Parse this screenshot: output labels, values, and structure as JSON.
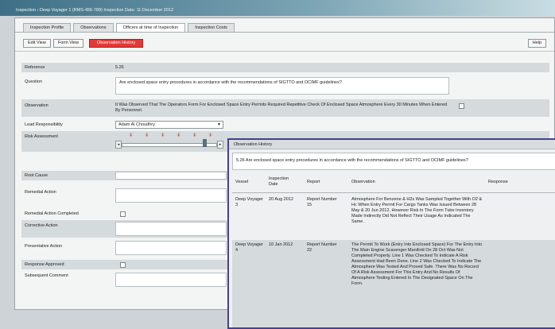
{
  "window_title": "Inspection › Deep Voyager 1 (RMS-456-789) Inspection Date: 11 December 2012",
  "tabs": [
    "Inspection Profile",
    "Observations",
    "Officers at time of Inspection",
    "Inspection Costs"
  ],
  "toolbar": {
    "edit_view": "Edit View",
    "form_view": "Form View",
    "observation_history": "Observation History",
    "help": "Help"
  },
  "form": {
    "reference": {
      "label": "Reference",
      "value": "5.26"
    },
    "question": {
      "label": "Question",
      "value": "Are enclosed space entry procedures in accordance with the recommendations of SIGTTO and OCIMF guidelines?"
    },
    "observation": {
      "label": "Observation",
      "value": "It Was Observed That The Operators Form For Enclosed Space Entry Permits Required Repetitive Check Of Enclosed Space Atmosphere Every 30 Minutes When Entered By Personnel."
    },
    "lead_responsibility": {
      "label": "Lead Responsibility",
      "value": "Adam Al Choudhry"
    },
    "risk_assessment": {
      "label": "Risk Assessment"
    },
    "root_cause": {
      "label": "Root Cause"
    },
    "remedial_action": {
      "label": "Remedial Action"
    },
    "remedial_completed": {
      "label": "Remedial Action Completed"
    },
    "corrective_action": {
      "label": "Corrective Action"
    },
    "preventative_action": {
      "label": "Preventative Action"
    },
    "response_approved": {
      "label": "Response Approved"
    },
    "subsequent_comment": {
      "label": "Subsequent Comment"
    }
  },
  "popup": {
    "title": "Observation History",
    "question": "5.26 Are enclosed space entry procedures in accordance with the recommendations of SIGTTO and OCIMF guidelines?",
    "headers": {
      "vessel": "Vessel",
      "date": "Inspection Date",
      "report": "Report",
      "observation": "Observation",
      "response": "Response"
    },
    "rows": [
      {
        "vessel": "Deep Voyager 3",
        "date": "20 Aug 2012",
        "report": "Report Number 15",
        "observation": "Atmosphere For Benzene & H2s Was Sampled Together With O2 & Hc When Entry Permit For Cargo Tanks Was Issued Between 28 May & 20 Jun 2012, However Risk In The Form Tube Inventory Made Indirectly Did Not Reflect Their Usage As Indicated The Same."
      },
      {
        "vessel": "Deep Voyager 4",
        "date": "10 Jan 2012",
        "report": "Report Number 22",
        "observation": "The Permit To Work (Entry Into Enclosed Space) For The Entry Into The Main Engine Scavenger Manifold On 28 Oct Was Not Completed Properly. Line 1 Was Checked To Indicate A Risk Assessment Had Been Done. Line 2 Was Checked To Indicate The Atmosphere Was Tested And Proved Safe. There Was No Record Of A Risk Assessment For This Entry And No Results Of Atmosphere Testing Entered In The Designated Space On The Form."
      }
    ]
  }
}
